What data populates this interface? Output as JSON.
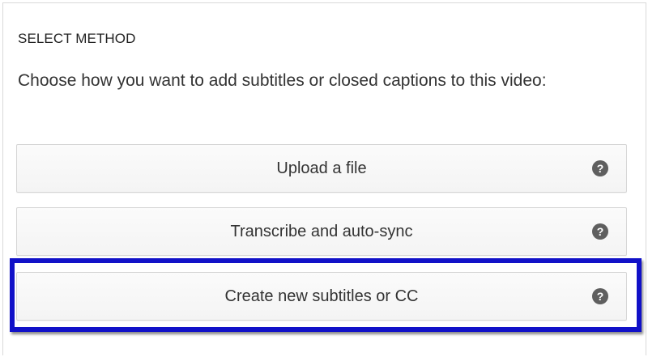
{
  "section": {
    "heading": "SELECT METHOD",
    "description": "Choose how you want to add subtitles or closed captions to this video:"
  },
  "methods": [
    {
      "label": "Upload a file",
      "help_icon": "question-circle-icon"
    },
    {
      "label": "Transcribe and auto-sync",
      "help_icon": "question-circle-icon"
    },
    {
      "label": "Create new subtitles or CC",
      "help_icon": "question-circle-icon"
    }
  ],
  "help_glyph": "?",
  "highlight": {
    "target": "Create new subtitles or CC",
    "color": "#1111c8"
  }
}
